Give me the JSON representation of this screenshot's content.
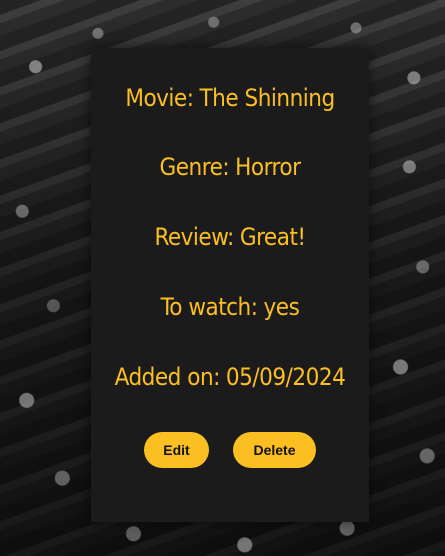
{
  "movie": {
    "title_label": "Movie:",
    "title_value": "The Shinning",
    "genre_label": "Genre:",
    "genre_value": "Horror",
    "review_label": "Review:",
    "review_value": "Great!",
    "to_watch_label": "To watch:",
    "to_watch_value": "yes",
    "added_label": "Added on:",
    "added_value": "05/09/2024"
  },
  "actions": {
    "edit_label": "Edit",
    "delete_label": "Delete"
  },
  "colors": {
    "accent": "#fbbf22",
    "card_background": "#1b1b1b",
    "button_text": "#111111"
  }
}
